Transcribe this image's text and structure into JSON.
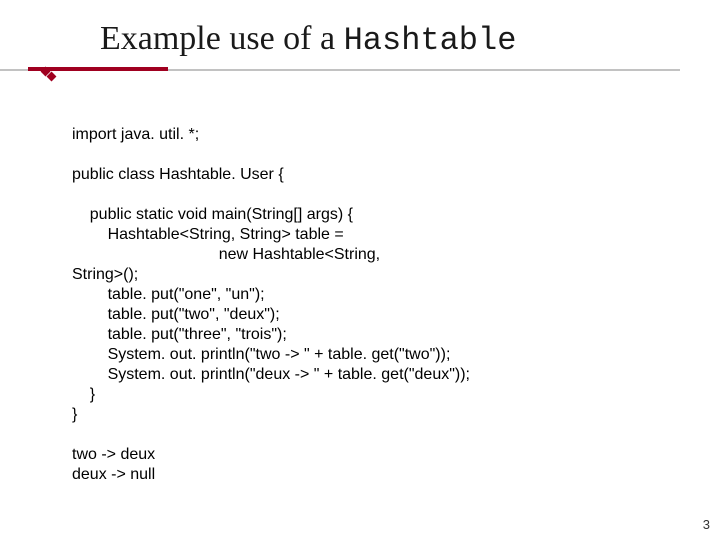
{
  "title": {
    "prefix": "Example use of a ",
    "mono": "Hashtable"
  },
  "code": {
    "l01": "import java. util. *;",
    "l02": "",
    "l03": "public class Hashtable. User {",
    "l04": "",
    "l05": "    public static void main(String[] args) {",
    "l06": "        Hashtable<String, String> table =",
    "l07": "                                 new Hashtable<String,",
    "l08": "String>();",
    "l09": "        table. put(\"one\", \"un\");",
    "l10": "        table. put(\"two\", \"deux\");",
    "l11": "        table. put(\"three\", \"trois\");",
    "l12": "        System. out. println(\"two -> \" + table. get(\"two\"));",
    "l13": "        System. out. println(\"deux -> \" + table. get(\"deux\"));",
    "l14": "    }",
    "l15": "}",
    "l16": "",
    "l17": "two -> deux",
    "l18": "deux -> null"
  },
  "pagenum": "3"
}
